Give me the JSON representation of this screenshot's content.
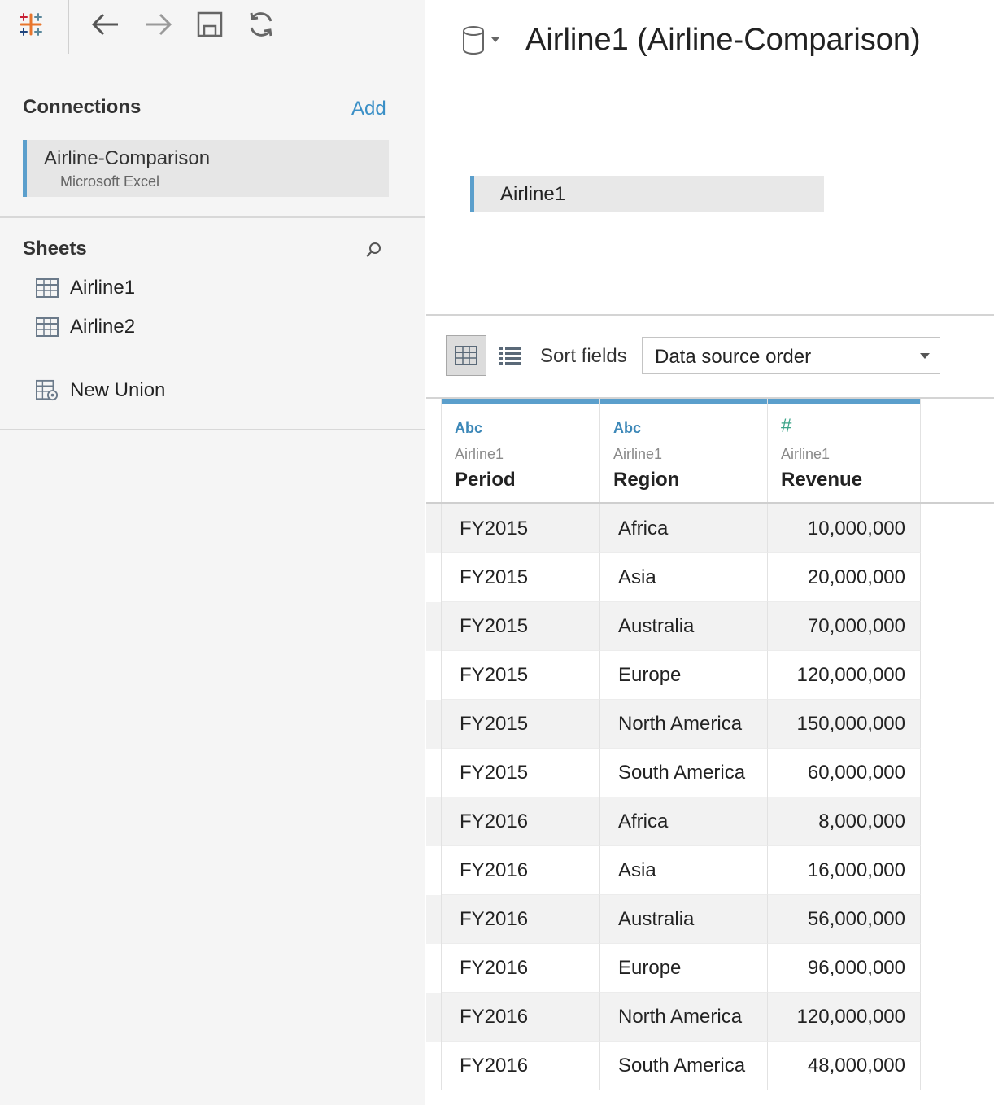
{
  "toolbar": {
    "logo_icon": "tableau-logo-icon",
    "back_icon": "arrow-left-icon",
    "forward_icon": "arrow-right-icon",
    "save_icon": "save-icon",
    "refresh_icon": "refresh-icon"
  },
  "connections": {
    "title": "Connections",
    "add_label": "Add",
    "items": [
      {
        "name": "Airline-Comparison",
        "type": "Microsoft Excel"
      }
    ]
  },
  "sheets": {
    "title": "Sheets",
    "items": [
      {
        "label": "Airline1",
        "icon": "sheet-table-icon"
      },
      {
        "label": "Airline2",
        "icon": "sheet-table-icon"
      }
    ],
    "new_union": {
      "label": "New Union",
      "icon": "union-icon"
    }
  },
  "datasource": {
    "title": "Airline1 (Airline-Comparison)",
    "icon": "database-icon"
  },
  "canvas": {
    "table_label": "Airline1"
  },
  "grid_toolbar": {
    "sort_label": "Sort fields",
    "sort_value": "Data source order"
  },
  "columns": [
    {
      "type": "Abc",
      "source": "Airline1",
      "name": "Period"
    },
    {
      "type": "Abc",
      "source": "Airline1",
      "name": "Region"
    },
    {
      "type": "#",
      "source": "Airline1",
      "name": "Revenue"
    }
  ],
  "rows": [
    {
      "period": "FY2015",
      "region": "Africa",
      "revenue": "10,000,000"
    },
    {
      "period": "FY2015",
      "region": "Asia",
      "revenue": "20,000,000"
    },
    {
      "period": "FY2015",
      "region": "Australia",
      "revenue": "70,000,000"
    },
    {
      "period": "FY2015",
      "region": "Europe",
      "revenue": "120,000,000"
    },
    {
      "period": "FY2015",
      "region": "North America",
      "revenue": "150,000,000"
    },
    {
      "period": "FY2015",
      "region": "South America",
      "revenue": "60,000,000"
    },
    {
      "period": "FY2016",
      "region": "Africa",
      "revenue": "8,000,000"
    },
    {
      "period": "FY2016",
      "region": "Asia",
      "revenue": "16,000,000"
    },
    {
      "period": "FY2016",
      "region": "Australia",
      "revenue": "56,000,000"
    },
    {
      "period": "FY2016",
      "region": "Europe",
      "revenue": "96,000,000"
    },
    {
      "period": "FY2016",
      "region": "North America",
      "revenue": "120,000,000"
    },
    {
      "period": "FY2016",
      "region": "South America",
      "revenue": "48,000,000"
    }
  ],
  "colors": {
    "accent": "#5b9fcc",
    "link": "#3a8fc6",
    "number_type": "#3ea58a"
  }
}
